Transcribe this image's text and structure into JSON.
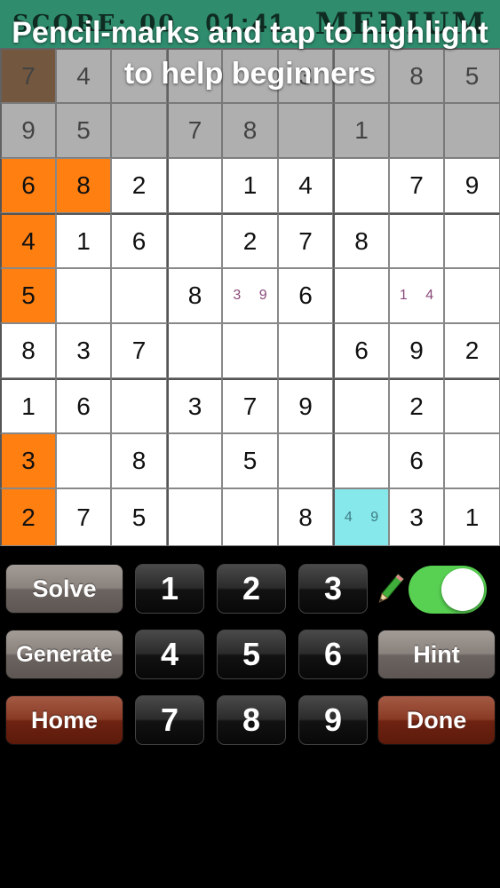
{
  "statusbar": {
    "score": "SCORE: 00",
    "timer": "01:41",
    "level": "MEDIUM"
  },
  "overlay_caption": "Pencil-marks and tap to highlight to help beginners",
  "board": {
    "rows": [
      [
        {
          "v": "7",
          "hl": "brown"
        },
        {
          "v": "4"
        },
        {
          "v": ""
        },
        {
          "v": ""
        },
        {
          "v": ""
        },
        {
          "v": "3"
        },
        {
          "v": ""
        },
        {
          "v": "8"
        },
        {
          "v": "5"
        }
      ],
      [
        {
          "v": "9"
        },
        {
          "v": "5"
        },
        {
          "v": ""
        },
        {
          "v": "7"
        },
        {
          "v": "8"
        },
        {
          "v": ""
        },
        {
          "v": "1"
        },
        {
          "v": ""
        },
        {
          "v": ""
        }
      ],
      [
        {
          "v": "6",
          "hl": "orange"
        },
        {
          "v": "8",
          "hl": "orange"
        },
        {
          "v": "2"
        },
        {
          "v": ""
        },
        {
          "v": "1"
        },
        {
          "v": "4"
        },
        {
          "v": ""
        },
        {
          "v": "7"
        },
        {
          "v": "9"
        }
      ],
      [
        {
          "v": "4",
          "hl": "orange"
        },
        {
          "v": "1"
        },
        {
          "v": "6"
        },
        {
          "v": ""
        },
        {
          "v": "2"
        },
        {
          "v": "7"
        },
        {
          "v": "8"
        },
        {
          "v": ""
        },
        {
          "v": ""
        }
      ],
      [
        {
          "v": "5",
          "hl": "orange"
        },
        {
          "v": ""
        },
        {
          "v": ""
        },
        {
          "v": "8"
        },
        {
          "pm": "3 9"
        },
        {
          "v": "6"
        },
        {
          "v": ""
        },
        {
          "pm": "1 4"
        },
        {
          "v": ""
        }
      ],
      [
        {
          "v": "8"
        },
        {
          "v": "3"
        },
        {
          "v": "7"
        },
        {
          "v": ""
        },
        {
          "v": ""
        },
        {
          "v": ""
        },
        {
          "v": "6"
        },
        {
          "v": "9"
        },
        {
          "v": "2"
        }
      ],
      [
        {
          "v": "1"
        },
        {
          "v": "6"
        },
        {
          "v": ""
        },
        {
          "v": "3"
        },
        {
          "v": "7"
        },
        {
          "v": "9"
        },
        {
          "v": ""
        },
        {
          "v": "2"
        },
        {
          "v": ""
        }
      ],
      [
        {
          "v": "3",
          "hl": "orange"
        },
        {
          "v": ""
        },
        {
          "v": "8"
        },
        {
          "v": ""
        },
        {
          "v": "5"
        },
        {
          "v": ""
        },
        {
          "v": ""
        },
        {
          "v": "6"
        },
        {
          "v": ""
        }
      ],
      [
        {
          "v": "2",
          "hl": "orange"
        },
        {
          "v": "7"
        },
        {
          "v": "5"
        },
        {
          "v": ""
        },
        {
          "v": ""
        },
        {
          "v": "8"
        },
        {
          "pm": "4 9",
          "hl": "cyan"
        },
        {
          "v": "3"
        },
        {
          "v": "1"
        }
      ]
    ]
  },
  "controls": {
    "solve_label": "Solve",
    "generate_label": "Generate",
    "home_label": "Home",
    "hint_label": "Hint",
    "done_label": "Done",
    "numbers": [
      "1",
      "2",
      "3",
      "4",
      "5",
      "6",
      "7",
      "8",
      "9"
    ],
    "pencil_mode": true
  },
  "colors": {
    "orange": "#ff7f11",
    "cyan": "#86e8ea",
    "toggle_on": "#58d152",
    "header": "#2f8d6e"
  }
}
